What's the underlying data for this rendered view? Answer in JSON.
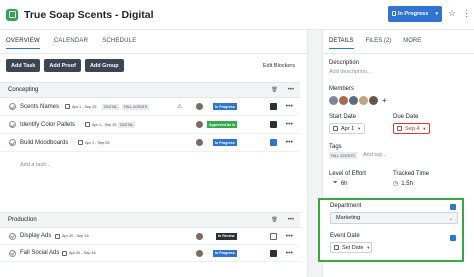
{
  "header": {
    "title": "True Soap Scents - Digital",
    "status_button": "In Progress",
    "caret": "▾",
    "icons": [
      "star-icon",
      "more-icon"
    ]
  },
  "left": {
    "tabs": [
      "OVERVIEW",
      "CALENDAR",
      "SCHEDULE"
    ],
    "buttons": [
      "Add Task",
      "Add Proof",
      "Add Group"
    ],
    "edit_blockers": "Edit Blockers",
    "sections": [
      {
        "name": "Concepting",
        "rows": [
          {
            "name": "Scents Names",
            "dates": "Apr 1 - Sep 25",
            "tags": [
              "DIGITAL",
              "FALL SCENTS"
            ],
            "status": "In Progress",
            "status_color": "#2f74d0"
          },
          {
            "name": "Identify Color Pallets",
            "dates": "Apr 1 - Sep 25",
            "tags": [
              "DIGITAL"
            ],
            "status": "Approved As Is",
            "status_color": "#36a84e"
          },
          {
            "name": "Build Moodboards",
            "dates": "Apr 1 - Sep 25",
            "tags": [],
            "status": "In Progress",
            "status_color": "#2f74d0"
          }
        ],
        "add_task": "Add a task..."
      },
      {
        "name": "Production",
        "rows": [
          {
            "name": "Display Ads",
            "dates": "Apr 20 - Sep 16",
            "tags": [],
            "status": "In Review",
            "status_color": "#2b2f36"
          },
          {
            "name": "Fall Social Ads",
            "dates": "Apr 20 - Sep 16",
            "tags": [],
            "status": "In Progress",
            "status_color": "#2f74d0"
          }
        ]
      }
    ],
    "more_glyph": "•••",
    "alert_glyph": "⚠",
    "collapse_glyph": "⌃",
    "trash_glyph": "🗑"
  },
  "right": {
    "tabs": [
      "DETAILS",
      "FILES (2)",
      "MORE"
    ],
    "description_label": "Description",
    "description_placeholder": "Add description...",
    "members_label": "Members",
    "member_colors": [
      "#7b8794",
      "#a86b4f",
      "#5b6b7f",
      "#c2a27d",
      "#6a5347"
    ],
    "start_date_label": "Start Date",
    "start_date": "Apr 1",
    "due_date_label": "Due Date",
    "due_date": "Sep 4",
    "due_date_color": "#d93b30",
    "tags_label": "Tags",
    "tag_chip": "FALL SCENTS",
    "tag_placeholder": "Add tag...",
    "level_label": "Level of Effort",
    "level_value": "6h",
    "tracked_label": "Tracked Time",
    "tracked_value": "1.5h",
    "department_label": "Department",
    "department_value": "Marketing",
    "event_date_label": "Event Date",
    "event_date_placeholder": "Set Date",
    "highlight_color": "#3aa648"
  }
}
